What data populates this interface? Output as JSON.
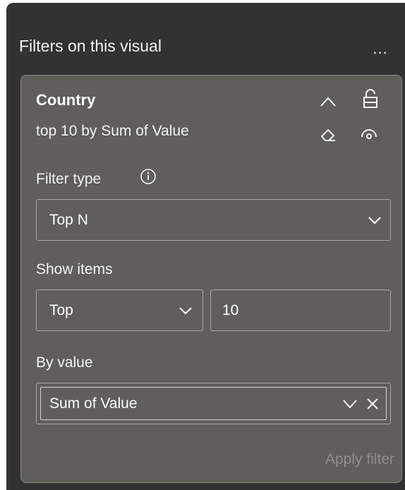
{
  "pane": {
    "title": "Filters on this visual",
    "more_label": "..."
  },
  "card": {
    "field_name": "Country",
    "summary": "top 10 by Sum of Value",
    "icons": {
      "collapse": "chevron-up-icon",
      "lock": "lock-icon",
      "clear": "eraser-icon",
      "visibility": "eye-icon"
    }
  },
  "filter_type": {
    "label": "Filter type",
    "info_icon": "info-icon",
    "value": "Top N"
  },
  "show_items": {
    "label": "Show items",
    "direction": "Top",
    "count": "10"
  },
  "by_value": {
    "label": "By value",
    "value": "Sum of Value",
    "icons": [
      "chevron-down-icon",
      "close-icon"
    ]
  },
  "apply_label": "Apply filter",
  "colors": {
    "pane_bg": "#323232",
    "card_bg": "#5f5e5b",
    "border": "#a7a6a3",
    "text": "#f2f2f2",
    "disabled_text": "#8e8d8a"
  }
}
